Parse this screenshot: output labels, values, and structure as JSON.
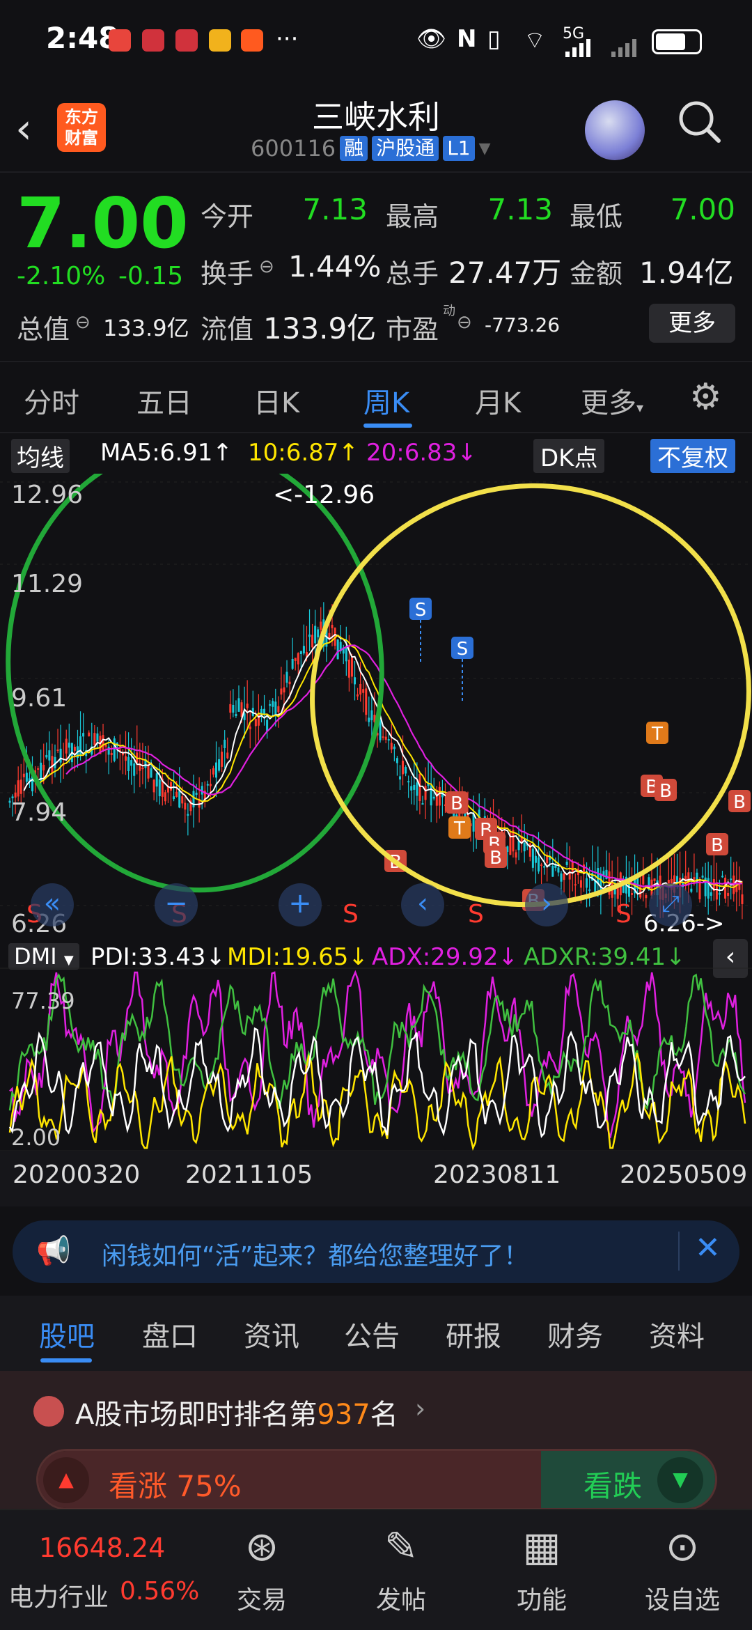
{
  "status_bar": {
    "time": "2:48",
    "dots": "···",
    "network": "5G"
  },
  "header": {
    "back_icon": "chevron-left-icon",
    "brand_logo": "东方\n财富",
    "stock_name": "三峡水利",
    "stock_code": "600116",
    "tags": [
      "融",
      "沪股通",
      "L1"
    ]
  },
  "quote": {
    "price": "7.00",
    "change_pct": "-2.10%",
    "change_abs": "-0.15",
    "open_label": "今开",
    "open": "7.13",
    "high_label": "最高",
    "high": "7.13",
    "low_label": "最低",
    "low": "7.00",
    "turnover_label": "换手",
    "turnover": "1.44%",
    "volume_label": "总手",
    "volume": "27.47万",
    "amount_label": "金额",
    "amount": "1.94亿",
    "mktcap_label": "总值",
    "mktcap": "133.9亿",
    "float_label": "流值",
    "float_cap": "133.9亿",
    "pe_label": "市盈",
    "pe_sup": "动",
    "pe": "-773.26",
    "more": "更多"
  },
  "period_tabs": [
    "分时",
    "五日",
    "日K",
    "周K",
    "月K",
    "更多"
  ],
  "active_period": "周K",
  "ma_legend": {
    "label": "均线",
    "ma5": "MA5:6.91↑",
    "ma10": "10:6.87↑",
    "ma20": "20:6.83↓",
    "dk": "DK点",
    "adjust": "不复权"
  },
  "kline": {
    "y_labels": [
      "12.96",
      "11.29",
      "9.61",
      "7.94",
      "6.26"
    ],
    "max_label": "<-12.96",
    "min_label": "6.26->",
    "signals_S": [
      "S",
      "S"
    ],
    "signal_B": "B",
    "signal_T": "T",
    "bottom_S": [
      "S",
      "S",
      "S",
      "S",
      "S"
    ]
  },
  "dmi": {
    "label": "DMI",
    "pdi": "PDI:33.43↓",
    "mdi": "MDI:19.65↓",
    "adx": "ADX:29.92↓",
    "adxr": "ADXR:39.41↓",
    "y_top": "77.39",
    "y_bottom": "2.00"
  },
  "dates": [
    "20200320",
    "20211105",
    "20230811",
    "20250509"
  ],
  "banner": {
    "text": "闲钱如何“活”起来？都给您整理好了！"
  },
  "info_tabs": [
    "股吧",
    "盘口",
    "资讯",
    "公告",
    "研报",
    "财务",
    "资料"
  ],
  "rank": {
    "prefix": "A股市场即时排名第",
    "rank": "937",
    "suffix": "名"
  },
  "vote": {
    "up": "看涨 75%",
    "down": "看跌",
    "up_pct": 0.75
  },
  "bottom_nav": {
    "index_value": "16648.24",
    "index_name": "电力行业",
    "index_change": "0.56%",
    "items": [
      "交易",
      "发帖",
      "功能",
      "设自选"
    ]
  },
  "colors": {
    "up": "#ff3b30",
    "down": "#22dd22",
    "accent": "#3a8df5",
    "ma5": "#ffffff",
    "ma10": "#ffe600",
    "ma20": "#e020e0"
  }
}
